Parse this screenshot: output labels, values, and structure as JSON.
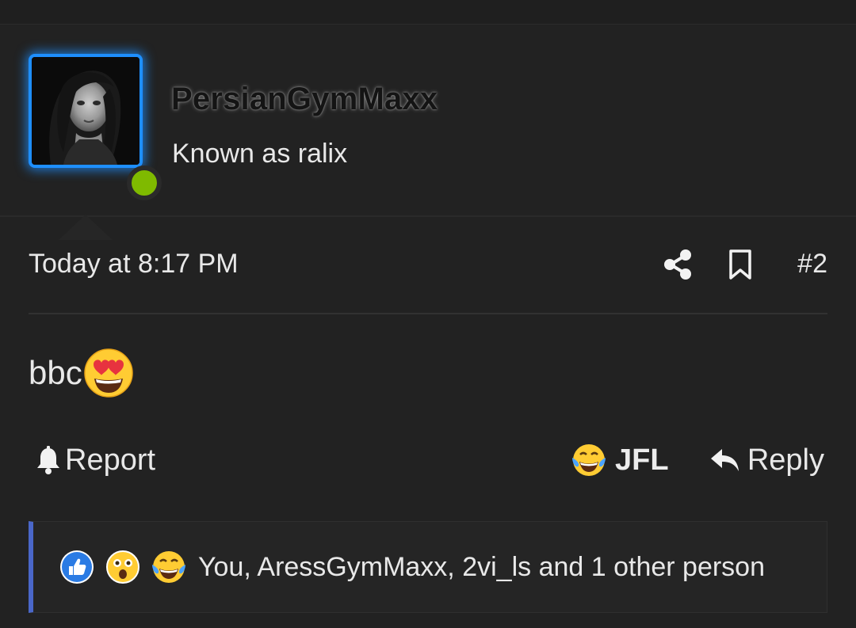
{
  "user": {
    "username": "PersianGymMaxx",
    "title": "Known as ralix",
    "online": true
  },
  "post": {
    "date": "Today at 8:17 PM",
    "number": "#2",
    "text": "bbc",
    "emoji_icon": "heart-eyes-emoji"
  },
  "actions": {
    "report_label": "Report",
    "jfl_label": "JFL",
    "reply_label": "Reply"
  },
  "reactions": {
    "icons": [
      "like-icon",
      "astonished-emoji",
      "crying-laughing-emoji"
    ],
    "summary": "You, AressGymMaxx, 2vi_ls and 1 other person"
  },
  "colors": {
    "background": "#222222",
    "avatar_border": "#1e8fff",
    "online": "#7fba00",
    "reaction_accent": "#4a67c9",
    "text": "#e8e8e8"
  }
}
